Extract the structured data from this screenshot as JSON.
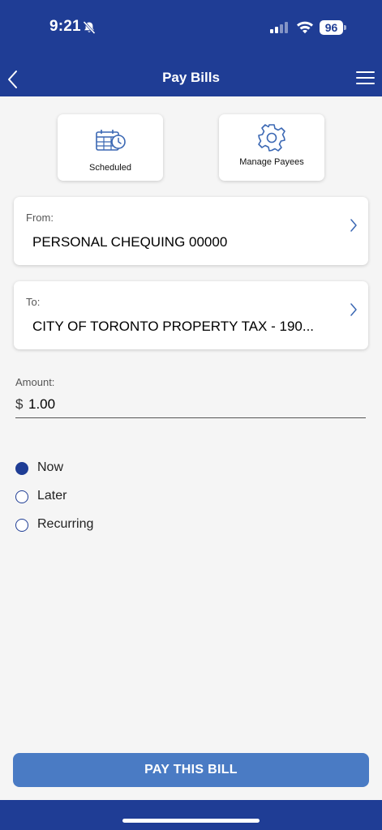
{
  "status_bar": {
    "time": "9:21",
    "battery": "96"
  },
  "nav": {
    "title": "Pay Bills"
  },
  "quick_actions": {
    "scheduled_label": "Scheduled",
    "manage_payees_label": "Manage Payees"
  },
  "from_card": {
    "label": "From:",
    "value": "PERSONAL CHEQUING 00000"
  },
  "to_card": {
    "label": "To:",
    "value": "CITY OF TORONTO PROPERTY TAX - 190..."
  },
  "amount": {
    "label": "Amount:",
    "currency": "$",
    "value": "1.00"
  },
  "timing_options": [
    {
      "label": "Now",
      "selected": true
    },
    {
      "label": "Later",
      "selected": false
    },
    {
      "label": "Recurring",
      "selected": false
    }
  ],
  "pay_button_label": "PAY THIS BILL",
  "colors": {
    "brand": "#1f3d95",
    "button": "#4a7bc4",
    "icon": "#3a67b3"
  }
}
